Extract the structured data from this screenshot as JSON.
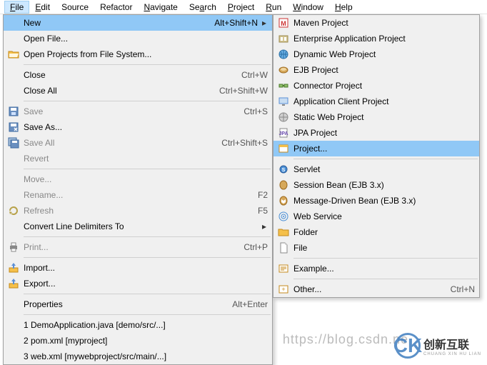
{
  "menubar": [
    {
      "label": "File",
      "active": true,
      "u": 0
    },
    {
      "label": "Edit",
      "u": 0
    },
    {
      "label": "Source",
      "u": null
    },
    {
      "label": "Refactor",
      "u": null
    },
    {
      "label": "Navigate",
      "u": 0
    },
    {
      "label": "Search",
      "u": 2
    },
    {
      "label": "Project",
      "u": 0
    },
    {
      "label": "Run",
      "u": 0
    },
    {
      "label": "Window",
      "u": 0
    },
    {
      "label": "Help",
      "u": 0
    }
  ],
  "fileMenu": [
    {
      "label": "New",
      "accel": "Alt+Shift+N",
      "arrow": true,
      "selected": true
    },
    {
      "label": "Open File..."
    },
    {
      "icon": "folder-open-icon",
      "label": "Open Projects from File System..."
    },
    {
      "sep": true
    },
    {
      "label": "Close",
      "accel": "Ctrl+W"
    },
    {
      "label": "Close All",
      "accel": "Ctrl+Shift+W"
    },
    {
      "sep": true
    },
    {
      "icon": "save-icon",
      "label": "Save",
      "accel": "Ctrl+S",
      "disabled": true
    },
    {
      "icon": "save-as-icon",
      "label": "Save As...",
      "disabled": false
    },
    {
      "icon": "save-all-icon",
      "label": "Save All",
      "accel": "Ctrl+Shift+S",
      "disabled": true
    },
    {
      "label": "Revert",
      "disabled": true
    },
    {
      "sep": true
    },
    {
      "label": "Move...",
      "disabled": true
    },
    {
      "label": "Rename...",
      "accel": "F2",
      "disabled": true
    },
    {
      "icon": "refresh-icon",
      "label": "Refresh",
      "accel": "F5",
      "disabled": true
    },
    {
      "label": "Convert Line Delimiters To",
      "arrow": true
    },
    {
      "sep": true
    },
    {
      "icon": "print-icon",
      "label": "Print...",
      "accel": "Ctrl+P",
      "disabled": true
    },
    {
      "sep": true
    },
    {
      "icon": "import-icon",
      "label": "Import..."
    },
    {
      "icon": "export-icon",
      "label": "Export..."
    },
    {
      "sep": true
    },
    {
      "label": "Properties",
      "accel": "Alt+Enter"
    },
    {
      "sep": true
    },
    {
      "label": "1 DemoApplication.java  [demo/src/...]"
    },
    {
      "label": "2 pom.xml  [myproject]"
    },
    {
      "label": "3 web.xml  [mywebproject/src/main/...]"
    }
  ],
  "newMenu": [
    {
      "icon": "maven-icon",
      "label": "Maven Project"
    },
    {
      "icon": "ear-icon",
      "label": "Enterprise Application Project"
    },
    {
      "icon": "globe-icon",
      "label": "Dynamic Web Project"
    },
    {
      "icon": "ejb-icon",
      "label": "EJB Project"
    },
    {
      "icon": "connector-icon",
      "label": "Connector Project"
    },
    {
      "icon": "appclient-icon",
      "label": "Application Client Project"
    },
    {
      "icon": "static-web-icon",
      "label": "Static Web Project"
    },
    {
      "icon": "jpa-icon",
      "label": "JPA Project"
    },
    {
      "icon": "project-icon",
      "label": "Project...",
      "selected": true
    },
    {
      "sep": true
    },
    {
      "icon": "servlet-icon",
      "label": "Servlet"
    },
    {
      "icon": "bean-icon",
      "label": "Session Bean (EJB 3.x)"
    },
    {
      "icon": "mdb-icon",
      "label": "Message-Driven Bean (EJB 3.x)"
    },
    {
      "icon": "ws-icon",
      "label": "Web Service"
    },
    {
      "icon": "folder-icon",
      "label": "Folder"
    },
    {
      "icon": "file-icon",
      "label": "File"
    },
    {
      "sep": true
    },
    {
      "icon": "example-icon",
      "label": "Example..."
    },
    {
      "sep": true
    },
    {
      "icon": "other-icon",
      "label": "Other...",
      "accel": "Ctrl+N"
    }
  ],
  "watermark": {
    "logo": "CK",
    "text": "创新互联",
    "sub": "CHUANG XIN HU LIAN"
  },
  "watermark_url": "https://blog.csdn.ne"
}
